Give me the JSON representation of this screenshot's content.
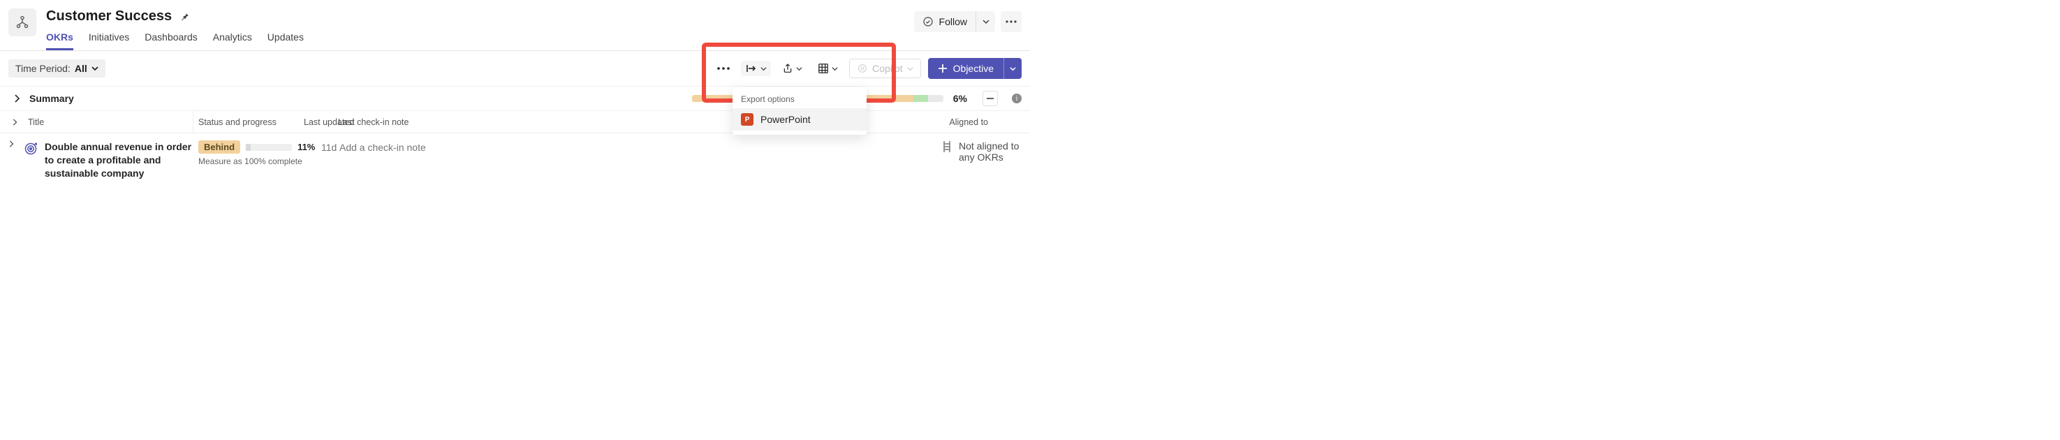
{
  "header": {
    "title": "Customer Success",
    "tabs": [
      "OKRs",
      "Initiatives",
      "Dashboards",
      "Analytics",
      "Updates"
    ],
    "active_tab": 0,
    "follow_label": "Follow"
  },
  "toolbar": {
    "time_label": "Time Period:",
    "time_value": "All",
    "copilot_label": "Copilot",
    "objective_label": "Objective",
    "export": {
      "title": "Export options",
      "items": [
        "PowerPoint"
      ]
    }
  },
  "summary": {
    "label": "Summary",
    "percent": "6%"
  },
  "columns": {
    "title": "Title",
    "status": "Status and progress",
    "updated": "Last updated",
    "note": "Last check-in note",
    "aligned": "Aligned to"
  },
  "rows": [
    {
      "title": "Double annual revenue in order to create a profitable and sustainable company",
      "status": "Behind",
      "percent": "11%",
      "measure": "Measure as 100% complete",
      "updated": "11d",
      "note_placeholder": "Add a check-in note",
      "aligned": "Not aligned to any OKRs"
    }
  ]
}
